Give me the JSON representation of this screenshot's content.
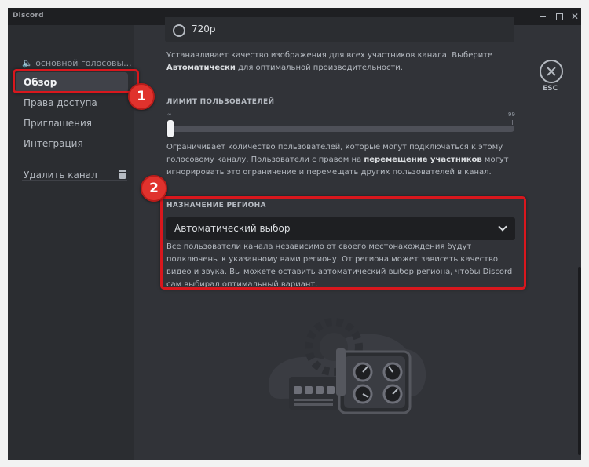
{
  "window": {
    "title": "Discord"
  },
  "sidebar": {
    "channel_header": "🔈 основной голосовы...",
    "items": [
      {
        "label": "Обзор",
        "active": true
      },
      {
        "label": "Права доступа"
      },
      {
        "label": "Приглашения"
      },
      {
        "label": "Интеграция"
      }
    ],
    "delete_label": "Удалить канал"
  },
  "video_quality": {
    "option_label": "720p",
    "desc_prefix": "Устанавливает качество изображения для всех участников канала. Выберите ",
    "desc_bold": "Автоматически",
    "desc_suffix": " для оптимальной производительности."
  },
  "user_limit": {
    "title": "ЛИМИТ ПОЛЬЗОВАТЕЛЕЙ",
    "min_label": "∞",
    "max_label": "99",
    "value": 0,
    "desc_prefix": "Ограничивает количество пользователей, которые могут подключаться к этому голосовому каналу. Пользователи с правом на ",
    "desc_bold": "перемещение участников",
    "desc_suffix": " могут игнорировать это ограничение и перемещать других пользователей в канал."
  },
  "region": {
    "title": "НАЗНАЧЕНИЕ РЕГИОНА",
    "selected": "Автоматический выбор",
    "desc": "Все пользователи канала независимо от своего местонахождения будут подключены к указанному вами региону. От региона может зависеть качество видео и звука. Вы можете оставить автоматический выбор региона, чтобы Discord сам выбирал оптимальный вариант."
  },
  "close": {
    "label": "ESC"
  },
  "annotations": {
    "badge1": "1",
    "badge2": "2",
    "color": "#d8171d"
  }
}
